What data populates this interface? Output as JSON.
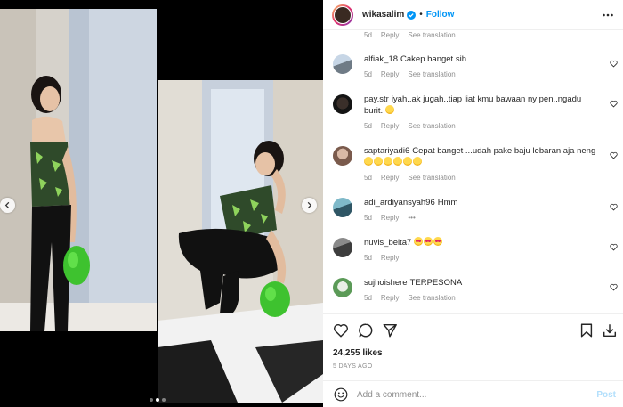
{
  "post": {
    "username": "wikasalim",
    "follow_label": "Follow",
    "separator": "•"
  },
  "top_meta": {
    "time": "5d",
    "reply": "Reply",
    "translation": "See translation"
  },
  "comments": [
    {
      "user": "alfiak_18",
      "text": "Cakep banget sih",
      "time": "5d",
      "reply": "Reply",
      "translation": "See translation"
    },
    {
      "user": "pay.str",
      "text": "iyah..ak jugah..tiap liat kmu bawaan ny pen..ngadu burit..",
      "time": "5d",
      "reply": "Reply",
      "translation": "See translation"
    },
    {
      "user": "saptariyadi6",
      "text": "Cepat banget ...udah pake baju lebaran aja neng",
      "time": "5d",
      "reply": "Reply",
      "translation": "See translation"
    },
    {
      "user": "adi_ardiyansyah96",
      "text": "Hmm",
      "time": "5d",
      "reply": "Reply",
      "more": "•••"
    },
    {
      "user": "nuvis_belta7",
      "text": "",
      "time": "5d",
      "reply": "Reply"
    },
    {
      "user": "sujhoishere",
      "text": "TERPESONA",
      "time": "5d",
      "reply": "Reply",
      "translation": "See translation"
    }
  ],
  "likes_text": "24,255 likes",
  "date_text": "5 DAYS AGO",
  "add_comment": {
    "placeholder": "Add a comment...",
    "post_label": "Post"
  },
  "colors": {
    "accent": "#0095f6",
    "text": "#262626",
    "muted": "#8e8e8e",
    "post_disabled": "#b2dffc"
  },
  "carousel": {
    "dot_count": 3,
    "active_dot": 2
  }
}
